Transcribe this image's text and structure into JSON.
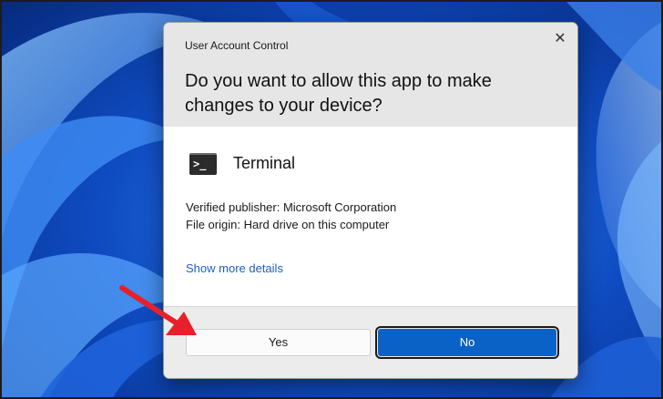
{
  "dialog": {
    "title": "User Account Control",
    "close_glyph": "✕",
    "question": "Do you want to allow this app to make changes to your device?",
    "app_name": "Terminal",
    "app_icon_glyph": ">_",
    "app_icon": "terminal-icon",
    "publisher_line": "Verified publisher: Microsoft Corporation",
    "origin_line": "File origin: Hard drive on this computer",
    "details_link": "Show more details",
    "yes_label": "Yes",
    "no_label": "No"
  },
  "colors": {
    "wallpaper_blue": "#0a3a9c",
    "header_gray": "#e6e6e6",
    "primary_button": "#0a62c6",
    "link": "#1d5fbf",
    "annotation_arrow": "#e8202a"
  }
}
